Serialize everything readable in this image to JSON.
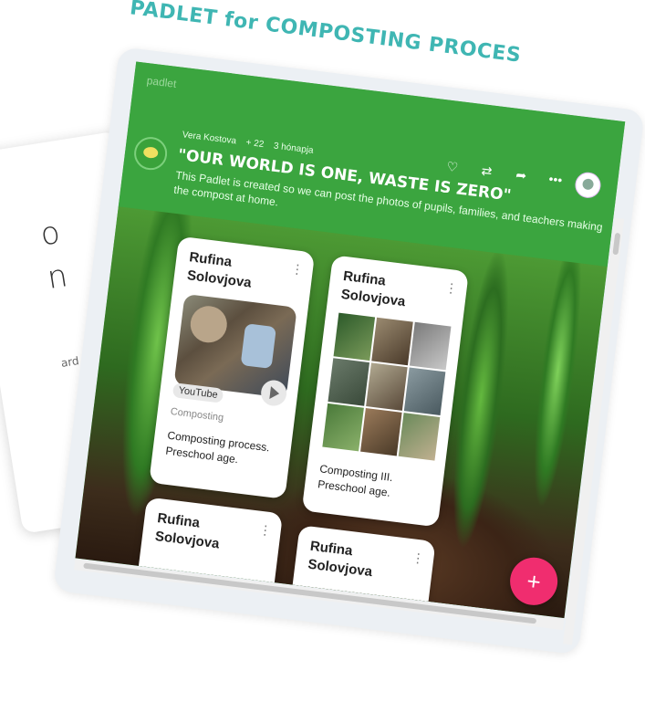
{
  "page": {
    "title": "PADLET for COMPOSTING PROCES"
  },
  "background_card": {
    "line1": "o",
    "line2": "n",
    "line3": "ard w"
  },
  "padlet": {
    "watermark": "padlet",
    "author": "Vera Kostova",
    "likes": "+ 22",
    "time": "3 hónapja",
    "title": "\"OUR WORLD IS ONE, WASTE IS ZERO\"",
    "description": "This Padlet is created so we can post the photos of pupils, families, and teachers making the compost at home.",
    "icons": [
      "heart-icon",
      "remake-icon",
      "share-icon",
      "more-icon"
    ],
    "icon_glyphs": [
      "♡",
      "⇄",
      "➦",
      "•••"
    ]
  },
  "posts": [
    {
      "author": "Rufina Solovjova",
      "badge": "YouTube",
      "tag": "Composting",
      "text": "Composting process. Preschool age."
    },
    {
      "author": "Rufina Solovjova",
      "text": "Composting III. Preschool age."
    },
    {
      "author": "Rufina Solovjova"
    },
    {
      "author": "Rufina Solovjova"
    }
  ],
  "fab": {
    "label": "+"
  },
  "colors": {
    "header": "#3ba53f",
    "title": "#3fb6b3",
    "fab": "#f02d6f"
  }
}
